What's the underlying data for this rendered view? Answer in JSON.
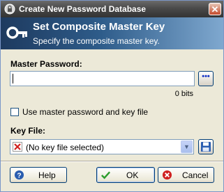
{
  "window": {
    "title": "Create New Password Database"
  },
  "banner": {
    "title": "Set Composite Master Key",
    "subtitle": "Specify the composite master key."
  },
  "master_password": {
    "label": "Master Password:",
    "value": "",
    "bits_text": "0 bits",
    "toggle_label": "•••"
  },
  "options": {
    "use_key_file_label": "Use master password and key file",
    "use_key_file_checked": false
  },
  "key_file": {
    "label": "Key File:",
    "selected": "(No key file selected)"
  },
  "buttons": {
    "help": "Help",
    "ok": "OK",
    "cancel": "Cancel"
  },
  "colors": {
    "banner_start": "#1e3a5f",
    "banner_end": "#7fa8cf",
    "ok_icon": "#2d9d2d",
    "cancel_icon": "#d02020",
    "help_icon": "#2a5db0"
  }
}
